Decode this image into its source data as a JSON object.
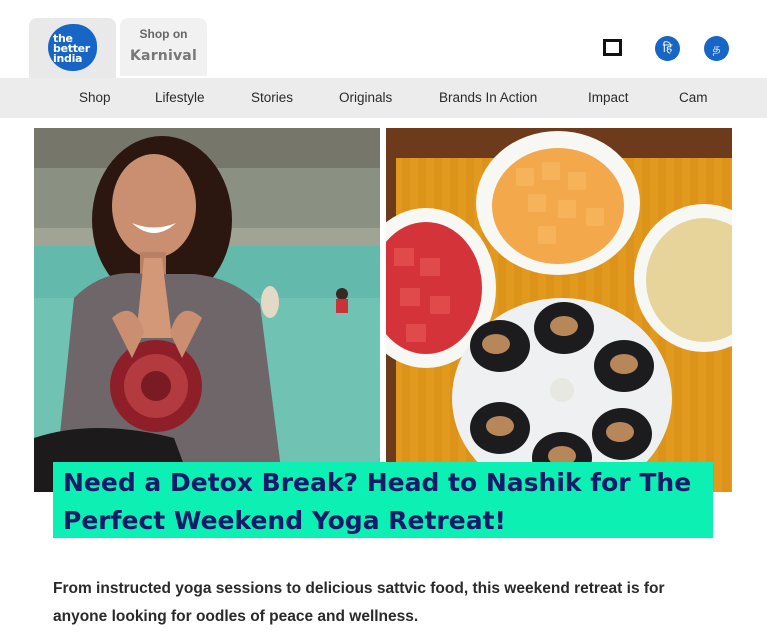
{
  "header": {
    "logo": {
      "line1": "the",
      "line2": "better",
      "line3": "india"
    },
    "shop": {
      "label": "Shop on",
      "brand": "Karnival"
    },
    "icons": {
      "bookmark": "square-outline-icon",
      "hindi": {
        "name": "hindi-language-icon",
        "glyph": "हि"
      },
      "tamil": {
        "name": "tamil-language-icon",
        "glyph": "த"
      }
    },
    "colors": {
      "brand_blue": "#1765c4",
      "nav_bg": "#ececec"
    }
  },
  "nav": {
    "items": [
      "Shop",
      "Lifestyle",
      "Stories",
      "Originals",
      "Brands In Action",
      "Impact",
      "Cam"
    ]
  },
  "article": {
    "title": "Need a Detox Break? Head to Nashik for The Perfect Weekend Yoga Retreat!",
    "summary": "From instructed yoga sessions to delicious sattvic food, this weekend retreat is for anyone looking for oodles of peace and wellness.",
    "title_band_color": "#0cf0b4",
    "title_color": "#17196a"
  }
}
